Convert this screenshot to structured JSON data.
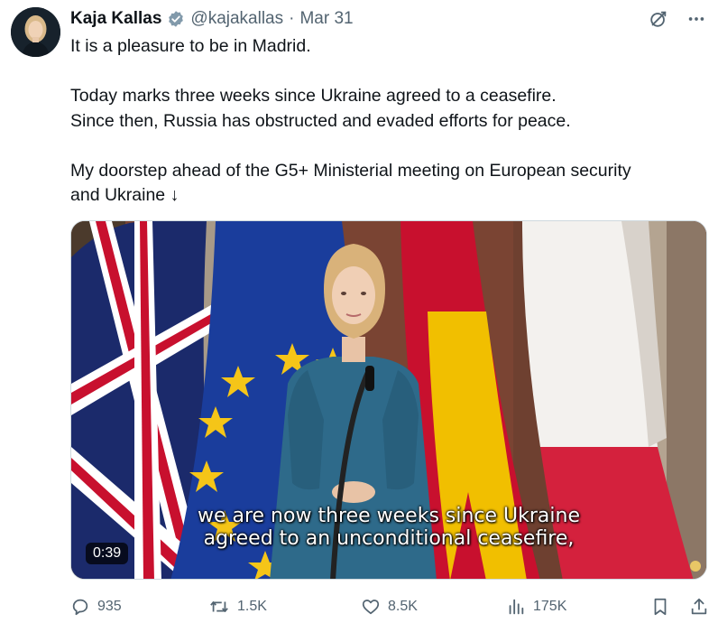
{
  "tweet": {
    "author_name": "Kaja Kallas",
    "handle": "@kajakallas",
    "separator": "·",
    "date": "Mar 31",
    "text_lines": [
      "It is a pleasure to be in Madrid.",
      "Today marks three weeks since Ukraine agreed to a ceasefire.",
      "Since then, Russia has obstructed and evaded efforts for peace.",
      "My doorstep ahead of the G5+ Ministerial meeting on European security",
      "and Ukraine ↓"
    ]
  },
  "video": {
    "subtitle_line1": "we are now three weeks since Ukraine",
    "subtitle_line2": "agreed to an unconditional ceasefire,",
    "duration": "0:39"
  },
  "actions": {
    "replies": "935",
    "reposts": "1.5K",
    "likes": "8.5K",
    "views": "175K"
  },
  "colors": {
    "text": "#0f1419",
    "secondary": "#536471",
    "verified": "#829aab",
    "eu_blue": "#1a3d9c",
    "eu_star": "#f5c518",
    "spain_red": "#c8102e",
    "spain_yellow": "#f1bf00",
    "dress": "#2e6a8a"
  },
  "icons": [
    "grok-icon",
    "more-icon",
    "reply-icon",
    "retweet-icon",
    "like-icon",
    "views-icon",
    "bookmark-icon",
    "share-icon",
    "verified-icon"
  ]
}
